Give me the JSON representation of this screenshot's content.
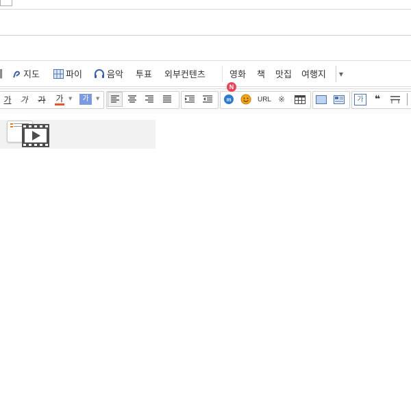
{
  "insert_toolbar": {
    "items": [
      {
        "label": "지도",
        "icon": "map-pin-icon"
      },
      {
        "label": "파이",
        "icon": "table-grid-icon"
      },
      {
        "label": "음악",
        "icon": "headphones-icon"
      },
      {
        "label": "투표",
        "icon": ""
      },
      {
        "label": "외부컨텐츠",
        "icon": ""
      },
      {
        "label": "영화",
        "icon": ""
      },
      {
        "label": "책",
        "icon": ""
      },
      {
        "label": "맛집",
        "icon": ""
      },
      {
        "label": "여행지",
        "icon": ""
      }
    ],
    "more_caret": "▼"
  },
  "format_toolbar": {
    "font_size_label": "가",
    "font_style_label": "가",
    "font_strike_label": "가",
    "font_color_label": "가",
    "bg_color_label": "가",
    "url_label": "URL",
    "special_char_label": "※",
    "quote_style_label": "가",
    "quote_mark": "❝",
    "new_badge": "N",
    "colors": {
      "font_color_bar": "#e4572e",
      "bg_color_swatch": "#7b9ae0",
      "new_badge_bg": "#e8455a",
      "naver_blue": "#2b7bd6",
      "emoticon_orange": "#f2a51a"
    }
  },
  "content": {
    "icons": [
      "document-icon",
      "video-icon"
    ]
  }
}
